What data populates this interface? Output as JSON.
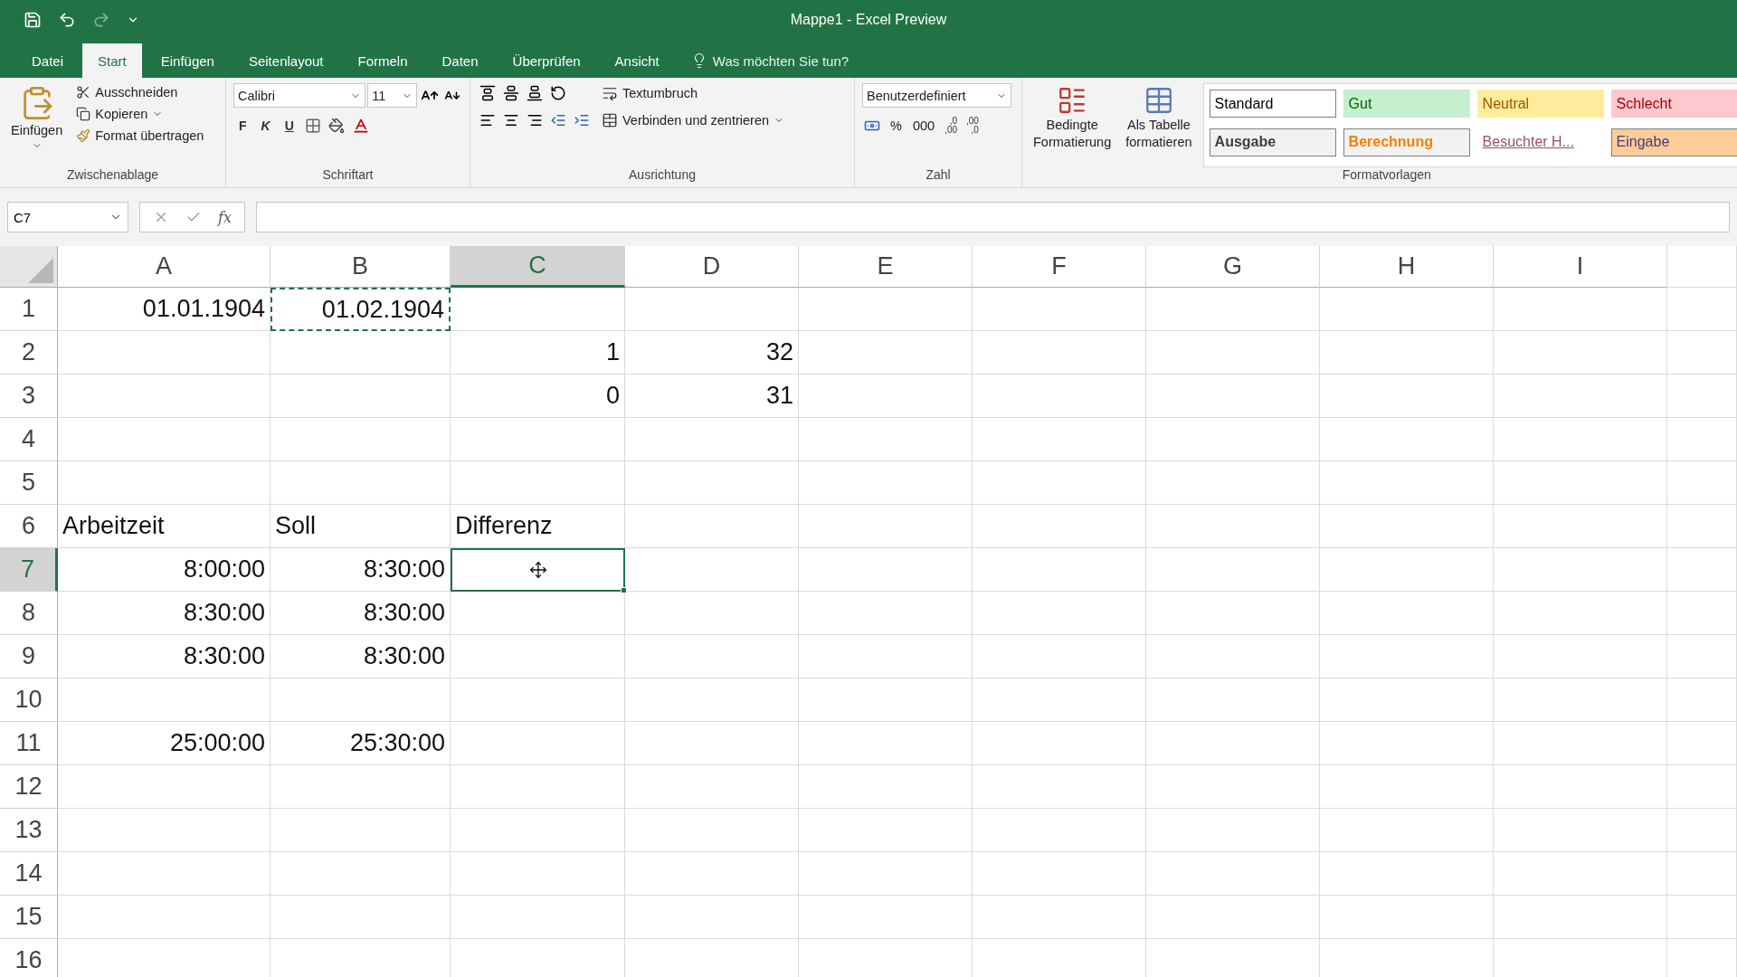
{
  "window": {
    "title": "Mappe1  -  Excel Preview"
  },
  "tabs": [
    {
      "label": "Datei",
      "selected": false
    },
    {
      "label": "Start",
      "selected": true
    },
    {
      "label": "Einfügen",
      "selected": false
    },
    {
      "label": "Seitenlayout",
      "selected": false
    },
    {
      "label": "Formeln",
      "selected": false
    },
    {
      "label": "Daten",
      "selected": false
    },
    {
      "label": "Überprüfen",
      "selected": false
    },
    {
      "label": "Ansicht",
      "selected": false
    }
  ],
  "tell_me": {
    "placeholder": "Was möchten Sie tun?"
  },
  "clipboard": {
    "group": "Zwischenablage",
    "paste": "Einfügen",
    "cut": "Ausschneiden",
    "copy": "Kopieren",
    "format_painter": "Format übertragen"
  },
  "font": {
    "group": "Schriftart",
    "font_name": "Calibri",
    "font_size": "11",
    "bold": "F",
    "italic": "K",
    "underline": "U"
  },
  "alignment": {
    "group": "Ausrichtung",
    "wrap_text": "Textumbruch",
    "merge": "Verbinden und zentrieren"
  },
  "number": {
    "group": "Zahl",
    "format": "Benutzerdefiniert",
    "percent": "%",
    "thousands": "000",
    "increase_decimal": [
      ",0",
      ",00"
    ],
    "decrease_decimal": [
      ",00",
      ",0"
    ]
  },
  "styles": {
    "group": "Formatvorlagen",
    "conditional": [
      "Bedingte",
      "Formatierung"
    ],
    "as_table": [
      "Als Tabelle",
      "formatieren"
    ],
    "gallery": [
      {
        "label": "Standard",
        "color": "#ffffff",
        "kind": "normal",
        "bordered": true,
        "bold": false,
        "underline": false
      },
      {
        "label": "Gut",
        "color": "#c6efce",
        "kind": "good",
        "bordered": false,
        "bold": false,
        "underline": false
      },
      {
        "label": "Neutral",
        "color": "#ffeb9c",
        "kind": "neutral",
        "bordered": false,
        "bold": false,
        "underline": false
      },
      {
        "label": "Schlecht",
        "color": "#ffc7ce",
        "kind": "bad",
        "bordered": false,
        "bold": false,
        "underline": false
      },
      {
        "label": "Ausgabe",
        "color": "#f2f2f2",
        "kind": "output",
        "bordered": true,
        "bold": true,
        "underline": false
      },
      {
        "label": "Berechnung",
        "color": "#f2f2f2",
        "kind": "calculation",
        "bordered": true,
        "bold": true,
        "underline": false
      },
      {
        "label": "Besuchter H...",
        "color": "#ffffff",
        "kind": "link",
        "bordered": false,
        "bold": false,
        "underline": true
      },
      {
        "label": "Eingabe",
        "color": "#ffcc99",
        "kind": "input",
        "bordered": true,
        "bold": false,
        "underline": false
      }
    ]
  },
  "formula_bar": {
    "name_box": "C7",
    "fx": "fx"
  },
  "columns": [
    {
      "label": "A",
      "selected": false
    },
    {
      "label": "B",
      "selected": false
    },
    {
      "label": "C",
      "selected": true
    },
    {
      "label": "D",
      "selected": false
    },
    {
      "label": "E",
      "selected": false
    },
    {
      "label": "F",
      "selected": false
    },
    {
      "label": "G",
      "selected": false
    },
    {
      "label": "H",
      "selected": false
    },
    {
      "label": "I",
      "selected": false
    }
  ],
  "rows": [
    {
      "label": "1",
      "selected": false,
      "cells": {
        "A": {
          "text": "01.01.1904",
          "kind": "number",
          "copied": false
        },
        "B": {
          "text": "01.02.1904",
          "kind": "number",
          "copied": true
        }
      }
    },
    {
      "label": "2",
      "selected": false,
      "cells": {
        "C": {
          "text": "1",
          "kind": "number",
          "copied": false
        },
        "D": {
          "text": "32",
          "kind": "number",
          "copied": false
        }
      }
    },
    {
      "label": "3",
      "selected": false,
      "cells": {
        "C": {
          "text": "0",
          "kind": "number",
          "copied": false
        },
        "D": {
          "text": "31",
          "kind": "number",
          "copied": false
        }
      }
    },
    {
      "label": "4",
      "selected": false,
      "cells": {}
    },
    {
      "label": "5",
      "selected": false,
      "cells": {}
    },
    {
      "label": "6",
      "selected": false,
      "cells": {
        "A": {
          "text": "Arbeitzeit",
          "kind": "text",
          "copied": false
        },
        "B": {
          "text": "Soll",
          "kind": "text",
          "copied": false
        },
        "C": {
          "text": "Differenz",
          "kind": "text",
          "copied": false
        }
      }
    },
    {
      "label": "7",
      "selected": true,
      "cells": {
        "A": {
          "text": "8:00:00",
          "kind": "number",
          "copied": false
        },
        "B": {
          "text": "8:30:00",
          "kind": "number",
          "copied": false
        }
      }
    },
    {
      "label": "8",
      "selected": false,
      "cells": {
        "A": {
          "text": "8:30:00",
          "kind": "number",
          "copied": false
        },
        "B": {
          "text": "8:30:00",
          "kind": "number",
          "copied": false
        }
      }
    },
    {
      "label": "9",
      "selected": false,
      "cells": {
        "A": {
          "text": "8:30:00",
          "kind": "number",
          "copied": false
        },
        "B": {
          "text": "8:30:00",
          "kind": "number",
          "copied": false
        }
      }
    },
    {
      "label": "10",
      "selected": false,
      "cells": {}
    },
    {
      "label": "11",
      "selected": false,
      "cells": {
        "A": {
          "text": "25:00:00",
          "kind": "number",
          "copied": false
        },
        "B": {
          "text": "25:30:00",
          "kind": "number",
          "copied": false
        }
      }
    },
    {
      "label": "12",
      "selected": false,
      "cells": {}
    },
    {
      "label": "13",
      "selected": false,
      "cells": {}
    },
    {
      "label": "14",
      "selected": false,
      "cells": {}
    },
    {
      "label": "15",
      "selected": false,
      "cells": {}
    },
    {
      "label": "16",
      "selected": false,
      "cells": {}
    }
  ]
}
